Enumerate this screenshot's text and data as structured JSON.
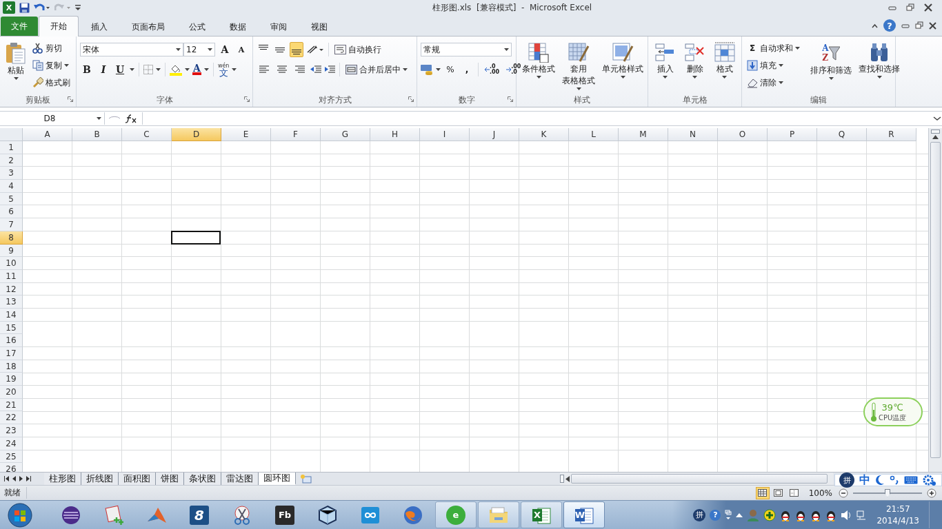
{
  "title_bar": {
    "app_logo": "X",
    "title": "柱形图.xls  [兼容模式]  -  Microsoft Excel"
  },
  "ribbon_tabs": [
    {
      "label": "文件",
      "kind": "file",
      "selected": false
    },
    {
      "label": "开始",
      "kind": "tab",
      "selected": true
    },
    {
      "label": "插入",
      "kind": "tab",
      "selected": false
    },
    {
      "label": "页面布局",
      "kind": "tab",
      "selected": false
    },
    {
      "label": "公式",
      "kind": "tab",
      "selected": false
    },
    {
      "label": "数据",
      "kind": "tab",
      "selected": false
    },
    {
      "label": "审阅",
      "kind": "tab",
      "selected": false
    },
    {
      "label": "视图",
      "kind": "tab",
      "selected": false
    }
  ],
  "help": "?",
  "clipboard": {
    "name": "剪贴板",
    "paste": "粘贴",
    "actions": [
      {
        "label": "剪切",
        "dropdown": false
      },
      {
        "label": "复制",
        "dropdown": true
      },
      {
        "label": "格式刷",
        "dropdown": false
      }
    ]
  },
  "font": {
    "name": "字体",
    "font_name": "宋体",
    "font_size": "12",
    "grow": "A",
    "shrink": "A",
    "styles": [
      "B",
      "I",
      "U"
    ],
    "font_color": "A",
    "phonetic_top": "wén",
    "phonetic": "文"
  },
  "alignment": {
    "name": "对齐方式",
    "vertical": [
      {
        "selected": false
      },
      {
        "selected": false
      },
      {
        "selected": true
      }
    ],
    "horizontal": [
      {
        "selected": false
      },
      {
        "selected": false
      },
      {
        "selected": false
      }
    ],
    "wrap": "自动换行",
    "merge": "合并后居中"
  },
  "number": {
    "name": "数字",
    "format": "常规",
    "percent": "%",
    "comma": ",",
    "increase_decimal": [
      ".0",
      ".00"
    ],
    "decrease_decimal": [
      ".00",
      ".0"
    ]
  },
  "styles": {
    "name": "样式",
    "buttons": [
      {
        "lines": [
          "条件格式"
        ]
      },
      {
        "lines": [
          "套用",
          "表格格式"
        ]
      },
      {
        "lines": [
          "单元格样式"
        ]
      }
    ]
  },
  "cells": {
    "name": "单元格",
    "buttons": [
      {
        "lines": [
          "插入"
        ]
      },
      {
        "lines": [
          "删除"
        ]
      },
      {
        "lines": [
          "格式"
        ]
      }
    ]
  },
  "editing": {
    "name": "编辑",
    "autosum_symbol": "Σ",
    "actions": [
      "自动求和",
      "填充",
      "清除"
    ],
    "sort_letters": [
      "A",
      "Z"
    ],
    "buttons": [
      {
        "lines": [
          "排序和筛选"
        ]
      },
      {
        "lines": [
          "查找和选择"
        ]
      }
    ]
  },
  "formula_bar": {
    "name_box": "D8"
  },
  "sheet": {
    "columns": [
      {
        "label": "A",
        "selected": false
      },
      {
        "label": "B",
        "selected": false
      },
      {
        "label": "C",
        "selected": false
      },
      {
        "label": "D",
        "selected": true
      },
      {
        "label": "E",
        "selected": false
      },
      {
        "label": "F",
        "selected": false
      },
      {
        "label": "G",
        "selected": false
      },
      {
        "label": "H",
        "selected": false
      },
      {
        "label": "I",
        "selected": false
      },
      {
        "label": "J",
        "selected": false
      },
      {
        "label": "K",
        "selected": false
      },
      {
        "label": "L",
        "selected": false
      },
      {
        "label": "M",
        "selected": false
      },
      {
        "label": "N",
        "selected": false
      },
      {
        "label": "O",
        "selected": false
      },
      {
        "label": "P",
        "selected": false
      },
      {
        "label": "Q",
        "selected": false
      },
      {
        "label": "R",
        "selected": false
      }
    ],
    "rows": [
      {
        "label": "1",
        "selected": false
      },
      {
        "label": "2",
        "selected": false
      },
      {
        "label": "3",
        "selected": false
      },
      {
        "label": "4",
        "selected": false
      },
      {
        "label": "5",
        "selected": false
      },
      {
        "label": "6",
        "selected": false
      },
      {
        "label": "7",
        "selected": false
      },
      {
        "label": "8",
        "selected": true
      },
      {
        "label": "9",
        "selected": false
      },
      {
        "label": "10",
        "selected": false
      },
      {
        "label": "11",
        "selected": false
      },
      {
        "label": "12",
        "selected": false
      },
      {
        "label": "13",
        "selected": false
      },
      {
        "label": "14",
        "selected": false
      },
      {
        "label": "15",
        "selected": false
      },
      {
        "label": "16",
        "selected": false
      },
      {
        "label": "17",
        "selected": false
      },
      {
        "label": "18",
        "selected": false
      },
      {
        "label": "19",
        "selected": false
      },
      {
        "label": "20",
        "selected": false
      },
      {
        "label": "21",
        "selected": false
      },
      {
        "label": "22",
        "selected": false
      },
      {
        "label": "23",
        "selected": false
      },
      {
        "label": "24",
        "selected": false
      },
      {
        "label": "25",
        "selected": false
      },
      {
        "label": "26",
        "selected": false
      }
    ]
  },
  "sheet_tabs": [
    {
      "label": "柱形图",
      "selected": false
    },
    {
      "label": "折线图",
      "selected": false
    },
    {
      "label": "面积图",
      "selected": false
    },
    {
      "label": "饼图",
      "selected": false
    },
    {
      "label": "条状图",
      "selected": false
    },
    {
      "label": "雷达图",
      "selected": false
    },
    {
      "label": "圆环图",
      "selected": true
    }
  ],
  "status_bar": {
    "status": "就绪",
    "views": [
      {
        "selected": true
      },
      {
        "selected": false
      },
      {
        "selected": false
      }
    ],
    "zoom": "100%",
    "zoom_slider": {
      "level": 0.5
    }
  },
  "cpu_widget": {
    "temperature": "39℃",
    "label": "CPU温度"
  },
  "ime_bar": {
    "logo": "拼",
    "mode": "中"
  },
  "taskbar": {
    "apps": [
      {
        "running": false,
        "selected": false
      },
      {
        "running": false,
        "selected": false
      },
      {
        "running": false,
        "selected": false
      },
      {
        "running": false,
        "selected": false,
        "label": "8"
      },
      {
        "running": false,
        "selected": false
      },
      {
        "running": false,
        "selected": false,
        "label": "Fb"
      },
      {
        "running": false,
        "selected": false
      },
      {
        "running": false,
        "selected": false
      },
      {
        "running": false,
        "selected": false
      },
      {
        "running": true,
        "selected": false,
        "label": "e"
      },
      {
        "running": true,
        "selected": false
      },
      {
        "running": true,
        "selected": false,
        "label": "X"
      },
      {
        "running": true,
        "selected": true,
        "label": "W"
      }
    ]
  },
  "tray": {
    "ime_logo": "拼",
    "help": "?",
    "time": "21:57",
    "date": "2014/4/13"
  }
}
